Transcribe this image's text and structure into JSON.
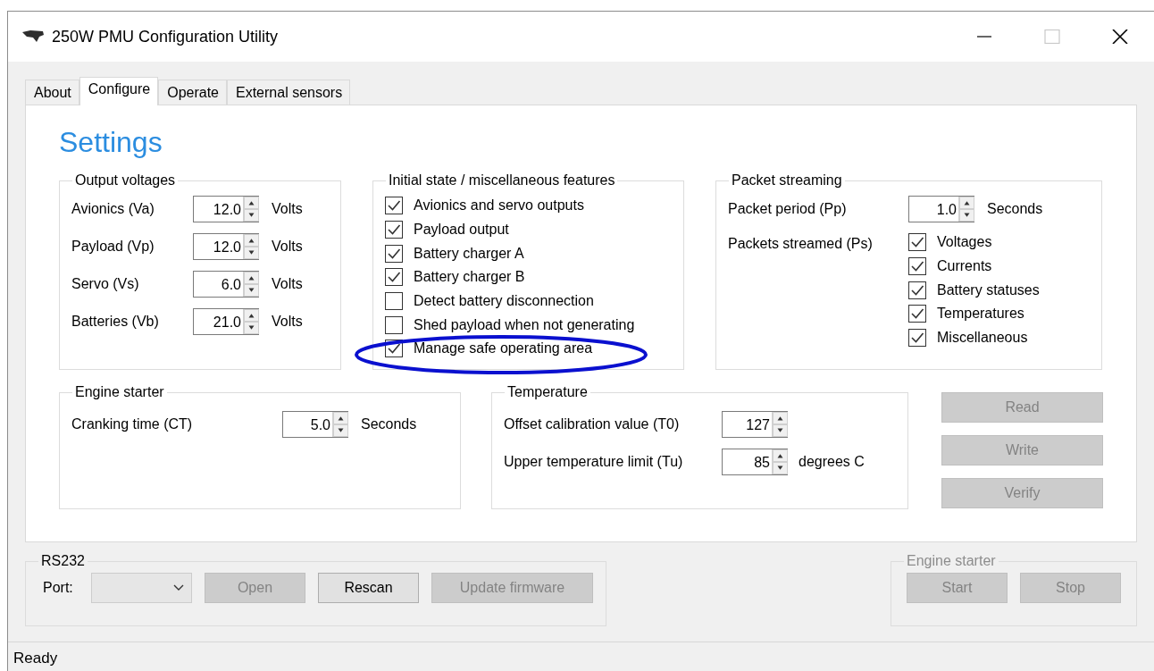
{
  "window": {
    "title": "250W PMU Configuration Utility"
  },
  "tabs": [
    {
      "label": "About",
      "selected": false
    },
    {
      "label": "Configure",
      "selected": true
    },
    {
      "label": "Operate",
      "selected": false
    },
    {
      "label": "External sensors",
      "selected": false
    }
  ],
  "heading": "Settings",
  "output_voltages": {
    "title": "Output voltages",
    "rows": [
      {
        "label": "Avionics (Va)",
        "value": "12.0",
        "unit": "Volts"
      },
      {
        "label": "Payload (Vp)",
        "value": "12.0",
        "unit": "Volts"
      },
      {
        "label": "Servo (Vs)",
        "value": "6.0",
        "unit": "Volts"
      },
      {
        "label": "Batteries (Vb)",
        "value": "21.0",
        "unit": "Volts"
      }
    ]
  },
  "initial_state": {
    "title": "Initial state / miscellaneous features",
    "options": [
      {
        "label": "Avionics and servo outputs",
        "checked": true
      },
      {
        "label": "Payload output",
        "checked": true
      },
      {
        "label": "Battery charger A",
        "checked": true
      },
      {
        "label": "Battery charger B",
        "checked": true
      },
      {
        "label": "Detect battery disconnection",
        "checked": false
      },
      {
        "label": "Shed payload when not generating",
        "checked": false
      },
      {
        "label": "Manage safe operating area",
        "checked": true
      }
    ]
  },
  "packet_streaming": {
    "title": "Packet streaming",
    "period": {
      "label": "Packet period (Pp)",
      "value": "1.0",
      "unit": "Seconds"
    },
    "streamed_label": "Packets streamed (Ps)",
    "packets": [
      {
        "label": "Voltages",
        "checked": true
      },
      {
        "label": "Currents",
        "checked": true
      },
      {
        "label": "Battery statuses",
        "checked": true
      },
      {
        "label": "Temperatures",
        "checked": true
      },
      {
        "label": "Miscellaneous",
        "checked": true
      }
    ]
  },
  "engine_starter": {
    "title": "Engine starter",
    "field": {
      "label": "Cranking time (CT)",
      "value": "5.0",
      "unit": "Seconds"
    }
  },
  "temperature": {
    "title": "Temperature",
    "rows": [
      {
        "label": "Offset calibration value (T0)",
        "value": "127"
      },
      {
        "label": "Upper temperature limit (Tu)",
        "value": "85",
        "unit": "degrees C"
      }
    ]
  },
  "actions": [
    {
      "label": "Read",
      "disabled": true
    },
    {
      "label": "Write",
      "disabled": true
    },
    {
      "label": "Verify",
      "disabled": true
    }
  ],
  "rs232": {
    "title": "RS232",
    "port_label": "Port:",
    "port_disabled": true,
    "buttons": [
      {
        "label": "Open",
        "disabled": true
      },
      {
        "label": "Rescan",
        "disabled": false
      },
      {
        "label": "Update firmware",
        "disabled": true
      }
    ]
  },
  "engine_control": {
    "title": "Engine starter",
    "disabled": true,
    "buttons": [
      {
        "label": "Start",
        "disabled": true
      },
      {
        "label": "Stop",
        "disabled": true
      }
    ]
  },
  "status_bar": "Ready"
}
